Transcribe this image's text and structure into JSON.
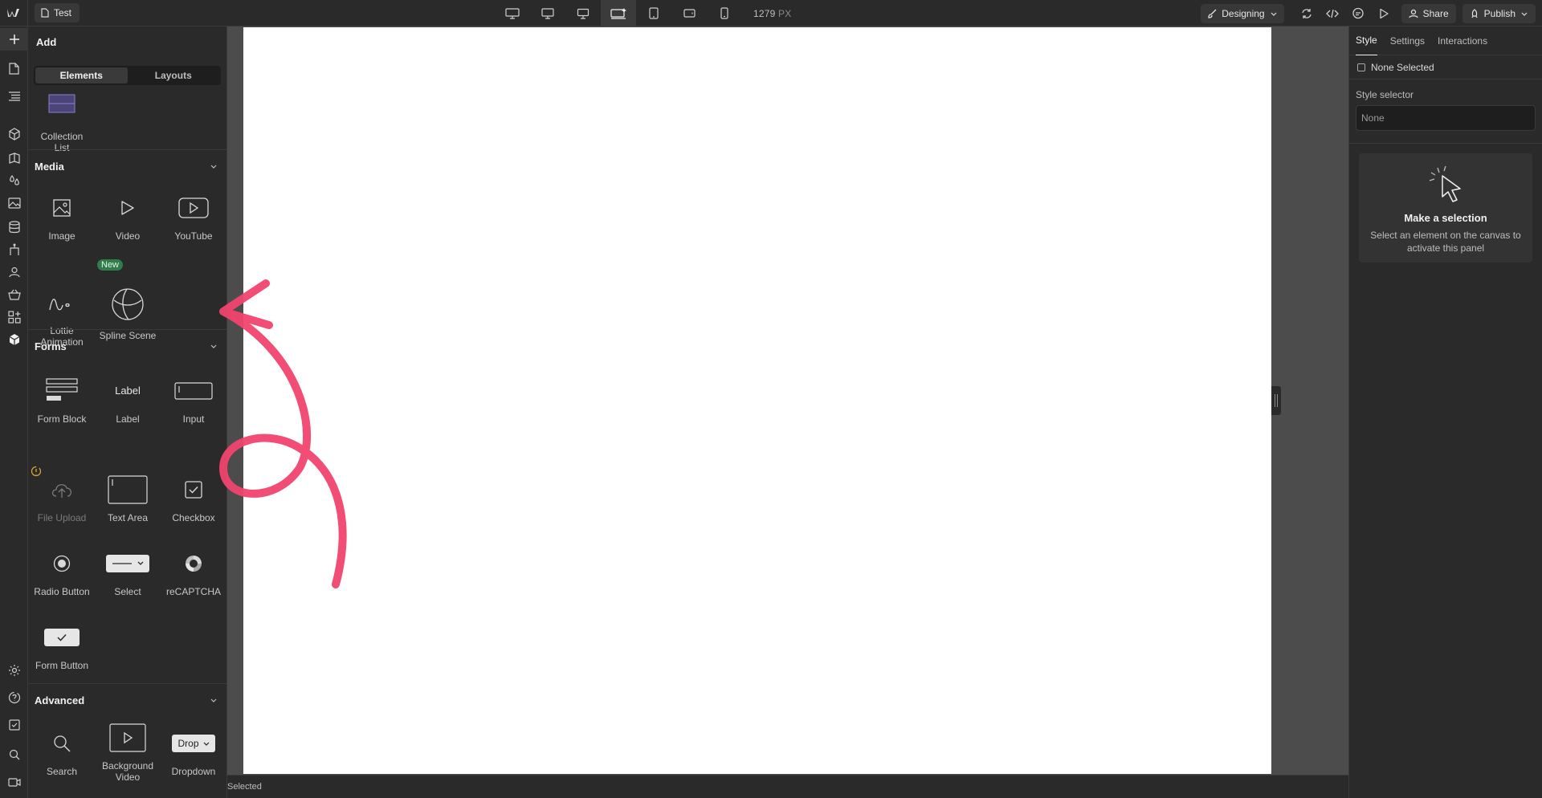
{
  "topbar": {
    "page_name": "Test",
    "breakpoints": [
      "desktop-xl-icon",
      "desktop-l-icon",
      "desktop-icon",
      "base-desktop-icon",
      "tablet-icon",
      "mobile-landscape-icon",
      "mobile-portrait-icon"
    ],
    "width_value": "1279",
    "width_unit": "PX",
    "mode_label": "Designing",
    "share_label": "Share",
    "publish_label": "Publish"
  },
  "add_panel": {
    "title": "Add",
    "tabs": [
      "Elements",
      "Layouts"
    ],
    "collection": {
      "label_1": "Collection",
      "label_2": "List"
    },
    "media": {
      "title": "Media",
      "items": [
        "Image",
        "Video",
        "YouTube",
        "Lottie",
        "Animation",
        "Spline Scene"
      ],
      "badge": "New"
    },
    "forms": {
      "title": "Forms",
      "items": [
        "Form Block",
        "Label",
        "Input",
        "File Upload",
        "Text Area",
        "Checkbox",
        "Radio Button",
        "Select",
        "reCAPTCHA",
        "Form Button"
      ],
      "label_preview": "Label"
    },
    "advanced": {
      "title": "Advanced",
      "items": [
        "Search",
        "Background",
        "Video",
        "Dropdown"
      ],
      "dropdown_preview": "Drop"
    }
  },
  "status": {
    "text": "Selected"
  },
  "right_panel": {
    "tabs": [
      "Style",
      "Settings",
      "Interactions"
    ],
    "selection": "None Selected",
    "style_selector_label": "Style selector",
    "style_selector_value": "None",
    "empty_title": "Make a selection",
    "empty_desc": "Select an element on the canvas to activate this panel"
  },
  "colors": {
    "accent": "#f0f0f0",
    "badge": "#2f7d4a",
    "annotation": "#f0436e",
    "canvas": "#ffffff"
  }
}
